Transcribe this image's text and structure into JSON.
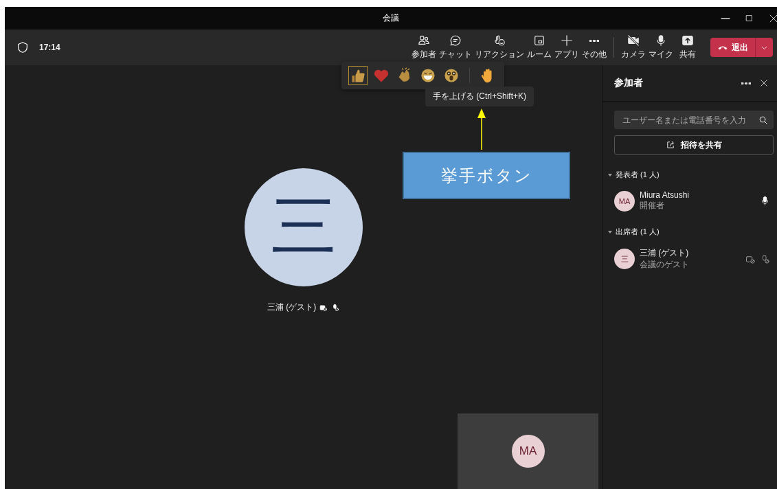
{
  "window": {
    "title": "会議"
  },
  "toolbar": {
    "time": "17:14",
    "buttons": [
      {
        "kind": "people",
        "label": "参加者"
      },
      {
        "kind": "chat",
        "label": "チャット"
      },
      {
        "kind": "reaction",
        "label": "リアクション"
      },
      {
        "kind": "room",
        "label": "ルーム"
      },
      {
        "kind": "apps",
        "label": "アプリ"
      },
      {
        "kind": "more",
        "label": "その他"
      }
    ],
    "device_buttons": [
      {
        "kind": "camera",
        "label": "カメラ"
      },
      {
        "kind": "mic",
        "label": "マイク"
      },
      {
        "kind": "share",
        "label": "共有"
      }
    ],
    "leave": {
      "label": "退出"
    }
  },
  "reactions": {
    "items": [
      {
        "kind": "like",
        "selected": true
      },
      {
        "kind": "heart",
        "selected": false
      },
      {
        "kind": "clap",
        "selected": false
      },
      {
        "kind": "laugh",
        "selected": false
      },
      {
        "kind": "surprised",
        "selected": false
      },
      {
        "kind": "hand",
        "selected": false
      }
    ],
    "tooltip": "手を上げる (Ctrl+Shift+K)"
  },
  "callout": "挙手ボタン",
  "stage": {
    "avatar": "三",
    "name": "三浦 (ゲスト)"
  },
  "self_view": {
    "initials": "MA"
  },
  "sidebar": {
    "title": "参加者",
    "search": {
      "placeholder": "ユーザー名または電話番号を入力"
    },
    "share_button": "招待を共有",
    "sections": [
      {
        "title": "発表者 (1 人)",
        "expanded": true,
        "people": [
          {
            "initials": "MA",
            "name": "Miura Atsushi",
            "role": "開催者",
            "muted": false
          }
        ]
      },
      {
        "title": "出席者 (1 人)",
        "expanded": true,
        "people": [
          {
            "initials": "三",
            "name": "三浦 (ゲスト)",
            "role": "会議のゲスト",
            "muted": true
          }
        ]
      }
    ]
  }
}
